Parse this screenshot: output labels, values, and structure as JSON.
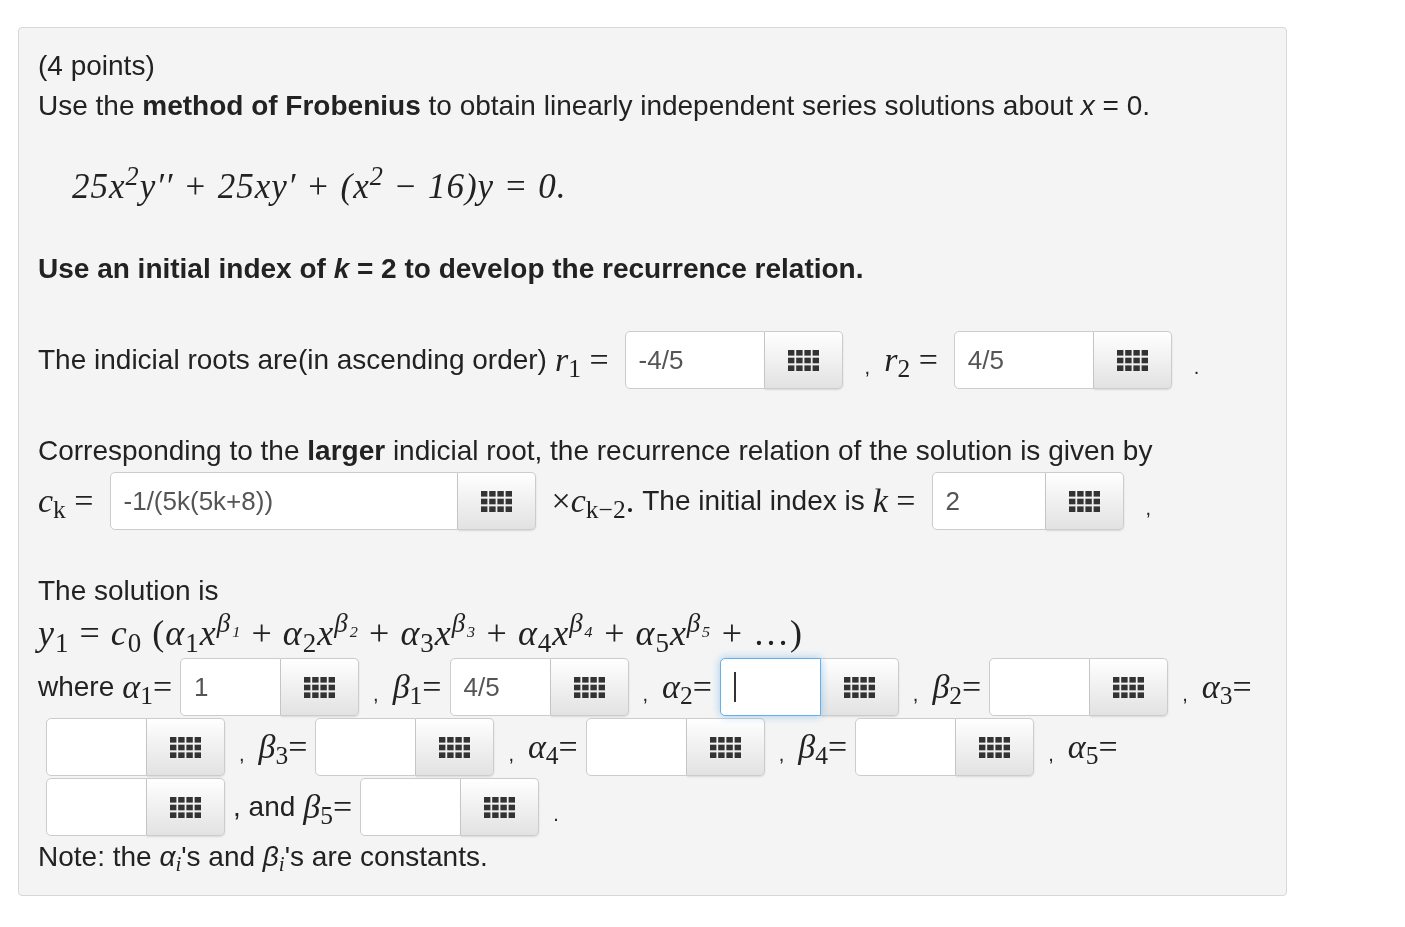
{
  "points": "(4 points)",
  "intro": "Use the **method of Frobenius** to obtain linearly independent series solutions about *x* = 0.",
  "equation": "25x$^{2}$y′′ + 25xy′ + (x$^{2}$ − 16)y = 0.",
  "instruction": "Use an initial index of *k* = 2 to develop the recurrence relation.",
  "roots_row": [
    {
      "kind": "text",
      "text": "The indicial roots are(in ascending order)"
    },
    {
      "kind": "math",
      "text": "*r*$_{1}$ ="
    },
    {
      "kind": "field",
      "value": "-4/5",
      "focused": false
    },
    {
      "kind": "punct",
      "text": ","
    },
    {
      "kind": "math",
      "text": "*r*$_{2}$ ="
    },
    {
      "kind": "field",
      "value": "4/5",
      "focused": false
    },
    {
      "kind": "punct",
      "text": "."
    }
  ],
  "recurrence_text": "Corresponding to the **larger** indicial root, the recurrence relation of the solution is given by",
  "recurrence_row": [
    {
      "kind": "math",
      "text": "*c*$_{k}$ ="
    },
    {
      "kind": "field",
      "value": "-1/(5k(5k+8))",
      "focused": false
    },
    {
      "kind": "math",
      "text": "×*c*$_{k−2}$."
    },
    {
      "kind": "text",
      "text": "The initial index is"
    },
    {
      "kind": "math",
      "text": "*k* ="
    },
    {
      "kind": "field",
      "value": "2",
      "focused": false
    },
    {
      "kind": "punct",
      "text": ","
    }
  ],
  "solution_label": "The solution is",
  "solution_formula": "*y*$_{1}$ = *c*$_{0}$ (*α*$_{1}$*x*$^{β₁}$ + *α*$_{2}$*x*$^{β₂}$ + *α*$_{3}$*x*$^{β₃}$ + *α*$_{4}$*x*$^{β₄}$ + *α*$_{5}$*x*$^{β₅}$ + …)",
  "coefficient_rows": [
    [
      {
        "kind": "text",
        "text": "where"
      },
      {
        "kind": "math",
        "text": "*α*$_{1}$="
      },
      {
        "kind": "field",
        "value": "1",
        "focused": false
      },
      {
        "kind": "punct",
        "text": ","
      },
      {
        "kind": "math",
        "text": "*β*$_{1}$="
      },
      {
        "kind": "field",
        "value": "4/5",
        "focused": false
      },
      {
        "kind": "punct",
        "text": ","
      },
      {
        "kind": "math",
        "text": "*α*$_{2}$="
      },
      {
        "kind": "field",
        "focused": true
      },
      {
        "kind": "punct",
        "text": ","
      },
      {
        "kind": "math",
        "text": "*β*$_{2}$="
      },
      {
        "kind": "field",
        "focused": false
      },
      {
        "kind": "punct",
        "text": ","
      },
      {
        "kind": "math",
        "text": "*α*$_{3}$="
      }
    ],
    [
      {
        "kind": "field",
        "focused": false
      },
      {
        "kind": "punct",
        "text": ","
      },
      {
        "kind": "math",
        "text": "*β*$_{3}$="
      },
      {
        "kind": "field",
        "focused": false
      },
      {
        "kind": "punct",
        "text": ","
      },
      {
        "kind": "math",
        "text": "*α*$_{4}$="
      },
      {
        "kind": "field",
        "focused": false
      },
      {
        "kind": "punct",
        "text": ","
      },
      {
        "kind": "math",
        "text": "*β*$_{4}$="
      },
      {
        "kind": "field",
        "focused": false
      },
      {
        "kind": "punct",
        "text": ","
      },
      {
        "kind": "math",
        "text": "*α*$_{5}$="
      }
    ],
    [
      {
        "kind": "field",
        "focused": false
      },
      {
        "kind": "text",
        "text": ", and"
      },
      {
        "kind": "math",
        "text": "*β*$_{5}$="
      },
      {
        "kind": "field",
        "focused": false
      },
      {
        "kind": "punct",
        "text": "."
      }
    ]
  ],
  "note": "Note: the *α*$_{i}$'s and *β*$_{i}$'s are constants."
}
